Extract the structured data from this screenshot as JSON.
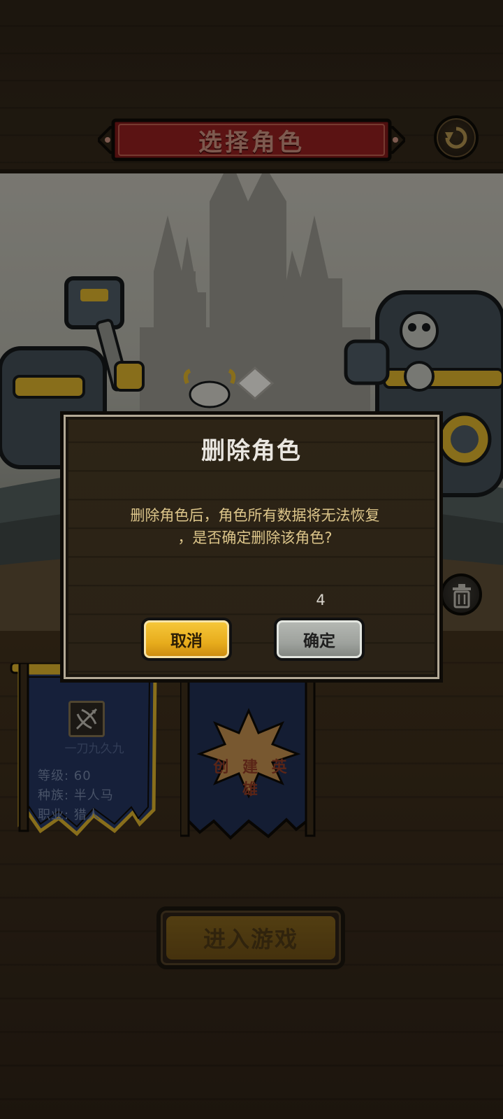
{
  "header": {
    "title": "选择角色"
  },
  "characters": [
    {
      "name": "一刀九久九",
      "level_label": "等级: 60",
      "race_label": "种族: 半人马",
      "class_label": "职业: 猎人"
    }
  ],
  "create_hero": {
    "label": "创 建 英 雄"
  },
  "enter_game": {
    "label": "进入游戏"
  },
  "dialog": {
    "title": "删除角色",
    "message_line1": "删除角色后，角色所有数据将无法恢复",
    "message_line2": "，是否确定删除该角色?",
    "countdown": "4",
    "cancel_label": "取消",
    "confirm_label": "确定"
  },
  "icons": {
    "back": "back-arrow-icon",
    "trash": "trash-icon",
    "class": "crossbow-icon"
  },
  "colors": {
    "cancel_button": "#e7ac1c",
    "confirm_button": "#9ea29d",
    "title_plaque": "#7a1717",
    "banner_blue": "#233562"
  }
}
